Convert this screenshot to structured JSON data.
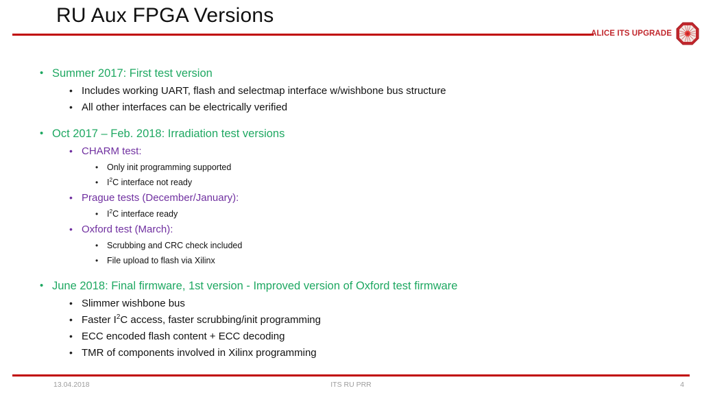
{
  "slide": {
    "title": "RU Aux FPGA Versions",
    "accent_color": "#C00000",
    "green_color": "#1FA862",
    "purple_color": "#7030A0"
  },
  "logo": {
    "text": "ALICE ITS UPGRADE",
    "mark": "alice-octagon-icon",
    "color": "#C1272D"
  },
  "bullets": {
    "b1": "Summer 2017: First test version",
    "b1s1": "Includes working UART, flash and selectmap interface w/wishbone bus structure",
    "b1s2": "All other interfaces can be electrically verified",
    "b2": "Oct 2017 – Feb. 2018: Irradiation test versions",
    "b2s1": "CHARM test:",
    "b2s1a": "Only init programming supported",
    "b2s1b_pre": "I",
    "b2s1b_sup": "2",
    "b2s1b_post": "C interface not ready",
    "b2s2": "Prague tests (December/January):",
    "b2s2a_pre": "I",
    "b2s2a_sup": "2",
    "b2s2a_post": "C interface ready",
    "b2s3": "Oxford test (March):",
    "b2s3a": "Scrubbing and CRC check  included",
    "b2s3b": "File upload to flash via Xilinx",
    "b3": "June 2018: Final firmware, 1st version - Improved version of Oxford test firmware",
    "b3s1": "Slimmer wishbone bus",
    "b3s2_pre": "Faster I",
    "b3s2_sup": "2",
    "b3s2_post": "C access, faster scrubbing/init programming",
    "b3s3": "ECC encoded flash content + ECC decoding",
    "b3s4": "TMR of components involved in Xilinx programming"
  },
  "marks": {
    "dot": "•"
  },
  "footer": {
    "date": "13.04.2018",
    "center": "ITS RU PRR",
    "page": "4"
  }
}
